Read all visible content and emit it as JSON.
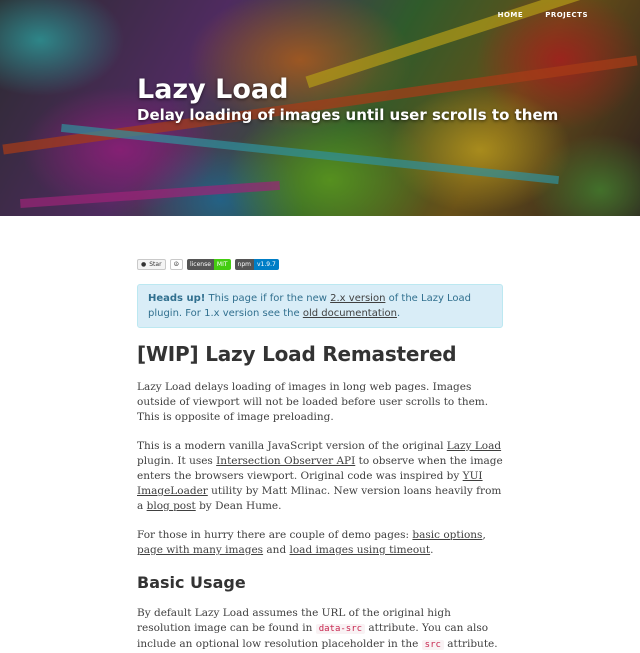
{
  "nav": {
    "home": "HOME",
    "projects": "PROJECTS"
  },
  "hero": {
    "title": "Lazy Load",
    "subtitle": "Delay loading of images until user scrolls to them"
  },
  "badges": {
    "star": "Star",
    "license_label": "license",
    "license_value": "MIT",
    "npm_label": "npm",
    "npm_value": "v1.9.7"
  },
  "alert": {
    "strong": "Heads up!",
    "t1": " This page if for the new ",
    "link1": "2.x version",
    "t2": " of the Lazy Load plugin. For 1.x version see the ",
    "link2": "old documentation",
    "t3": "."
  },
  "heading": "[WIP] Lazy Load Remastered",
  "para1": "Lazy Load delays loading of images in long web pages. Images outside of viewport will not be loaded before user scrolls to them. This is opposite of image preloading.",
  "para2": {
    "t1": "This is a modern vanilla JavaScript version of the original ",
    "link1": "Lazy Load",
    "t2": " plugin. It uses ",
    "link2": "Intersection Observer API",
    "t3": " to observe when the image enters the browsers viewport. Original code was inspired by ",
    "link3": "YUI ImageLoader",
    "t4": " utility by Matt Mlinac. New version loans heavily from a ",
    "link4": "blog post",
    "t5": " by Dean Hume."
  },
  "para3": {
    "t1": "For those in hurry there are couple of demo pages: ",
    "link1": "basic options",
    "t2": ", ",
    "link2": "page with many images",
    "t3": " and ",
    "link3": "load images using timeout",
    "t4": "."
  },
  "subheading": "Basic Usage",
  "para4": {
    "t1": "By default Lazy Load assumes the URL of the original high resolution image can be found in ",
    "code1": "data-src",
    "t2": " attribute. You can also include an optional low resolution placeholder in the ",
    "code2": "src",
    "t3": " attribute."
  }
}
